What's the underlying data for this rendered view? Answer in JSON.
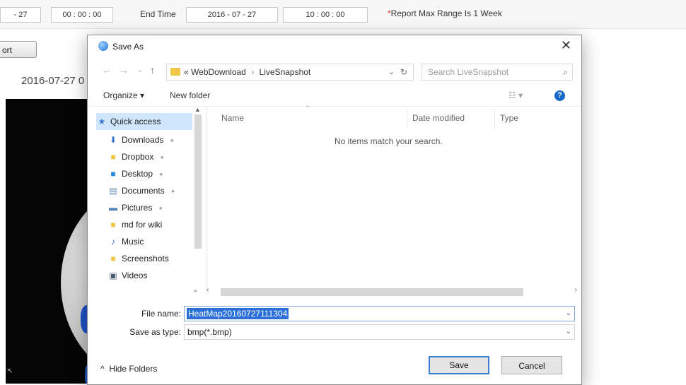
{
  "page": {
    "start_day": "- 27",
    "start_time": "00 : 00 : 00",
    "end_time_label": "End Time",
    "end_date": "2016 - 07 - 27",
    "end_time": "10 : 00 : 00",
    "range_note": "Report Max Range Is 1 Week",
    "export_button": "ort",
    "datetime": "2016-07-27 0"
  },
  "dialog": {
    "title": "Save As",
    "address": {
      "prefix": "«",
      "crumbs": [
        "WebDownload",
        "LiveSnapshot"
      ],
      "separator": "›"
    },
    "search_placeholder": "Search LiveSnapshot",
    "toolbar": {
      "organize": "Organize ▾",
      "new_folder": "New folder"
    },
    "nav_items": [
      {
        "label": "Quick access",
        "icon": "star-icon"
      },
      {
        "label": "Downloads",
        "icon": "download-icon"
      },
      {
        "label": "Dropbox",
        "icon": "folder-icon"
      },
      {
        "label": "Desktop",
        "icon": "desktop-icon"
      },
      {
        "label": "Documents",
        "icon": "document-icon"
      },
      {
        "label": "Pictures",
        "icon": "picture-icon"
      },
      {
        "label": "md for wiki",
        "icon": "folder-icon"
      },
      {
        "label": "Music",
        "icon": "music-icon"
      },
      {
        "label": "Screenshots",
        "icon": "folder-icon"
      },
      {
        "label": "Videos",
        "icon": "video-icon"
      }
    ],
    "columns": {
      "name": "Name",
      "date_modified": "Date modified",
      "type": "Type"
    },
    "empty_message": "No items match your search.",
    "file_name_label": "File name:",
    "file_name_value": "HeatMap20160727111304",
    "save_type_label": "Save as type:",
    "save_type_value": "bmp(*.bmp)",
    "hide_folders": "Hide Folders",
    "save_button": "Save",
    "cancel_button": "Cancel",
    "colors": {
      "selection": "#2a70d8",
      "nav_selected": "#cfe5fa",
      "help_icon": "#1669c9"
    }
  }
}
